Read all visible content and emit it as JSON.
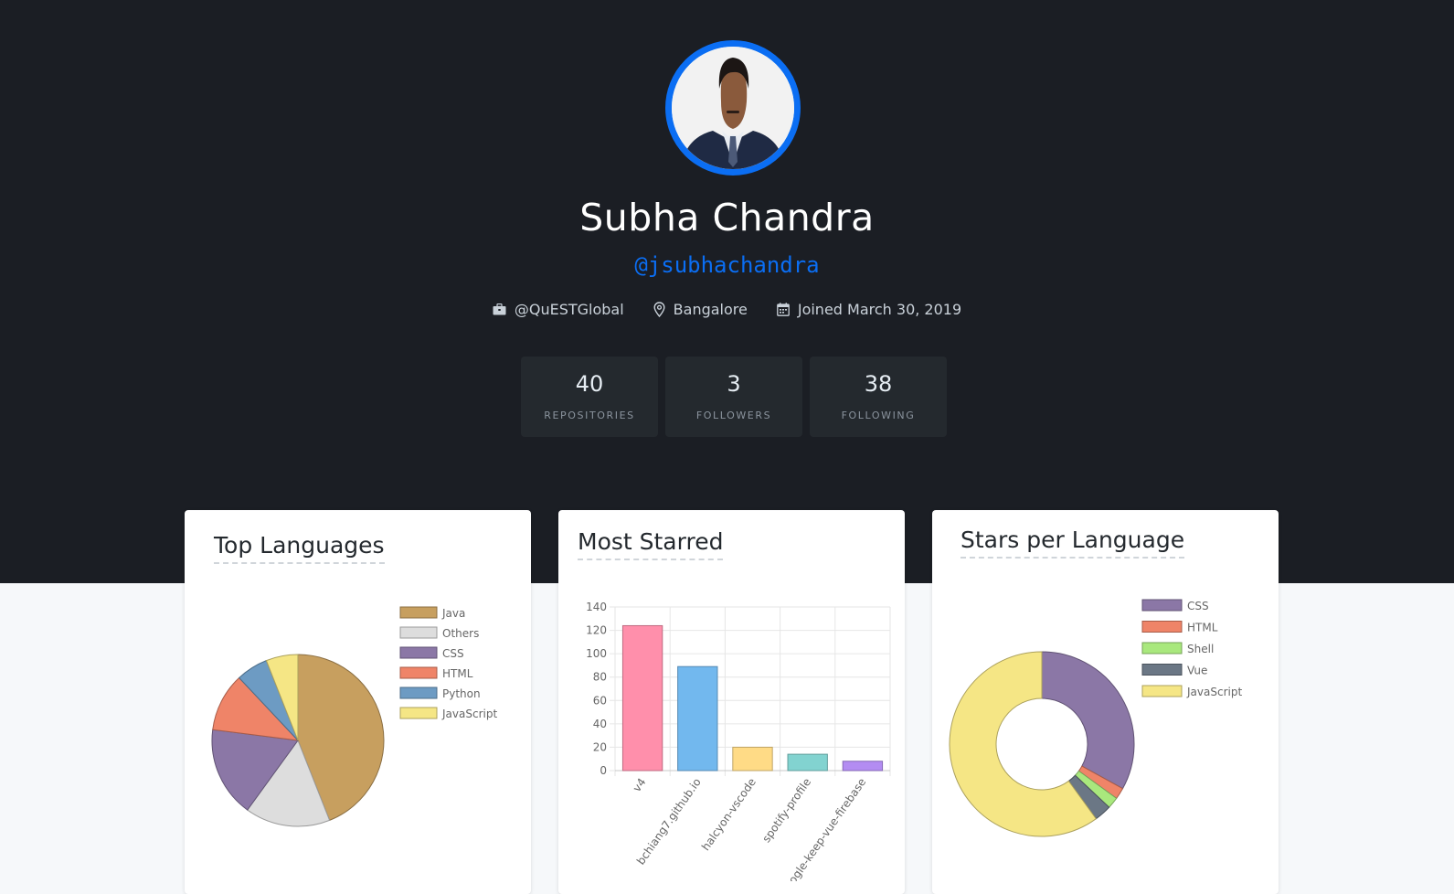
{
  "profile": {
    "name": "Subha Chandra",
    "handle": "@jsubhachandra",
    "company": "@QuESTGlobal",
    "location": "Bangalore",
    "joined": "Joined March 30, 2019",
    "icons": [
      "briefcase-icon",
      "location-pin-icon",
      "calendar-icon"
    ],
    "accent_color": "#0b6ef3"
  },
  "stats": [
    {
      "value": "40",
      "label": "REPOSITORIES"
    },
    {
      "value": "3",
      "label": "FOLLOWERS"
    },
    {
      "value": "38",
      "label": "FOLLOWING"
    }
  ],
  "cards": {
    "top_languages": "Top Languages",
    "most_starred": "Most Starred",
    "stars_per_language": "Stars per Language"
  },
  "chart_data": [
    {
      "type": "pie",
      "title": "Top Languages",
      "legend_position": "top-right",
      "categories": [
        "Java",
        "Others",
        "CSS",
        "HTML",
        "Python",
        "JavaScript"
      ],
      "values": [
        44,
        16,
        17,
        11,
        6,
        6
      ],
      "colors": [
        "#c79f5f",
        "#dddddd",
        "#8b77a6",
        "#ef8468",
        "#6d9bc3",
        "#f5e685"
      ]
    },
    {
      "type": "bar",
      "title": "Most Starred",
      "categories": [
        "v4",
        "bchiang7.github.io",
        "halcyon-vscode",
        "spotify-profile",
        "google-keep-vue-firebase"
      ],
      "values": [
        124,
        89,
        20,
        14,
        8
      ],
      "ylim": [
        0,
        140
      ],
      "yticks": [
        0,
        20,
        40,
        60,
        80,
        100,
        120,
        140
      ],
      "grid": true,
      "colors": [
        "#ff8fab",
        "#72b8ee",
        "#ffdb86",
        "#82d3d0",
        "#b38cf2"
      ]
    },
    {
      "type": "pie",
      "subtype": "doughnut",
      "title": "Stars per Language",
      "legend_position": "top-right",
      "categories": [
        "CSS",
        "HTML",
        "Shell",
        "Vue",
        "JavaScript"
      ],
      "values": [
        33,
        2,
        2,
        3,
        60
      ],
      "colors": [
        "#8b77a6",
        "#ef8468",
        "#a9e87d",
        "#6b7785",
        "#f5e685"
      ]
    }
  ]
}
